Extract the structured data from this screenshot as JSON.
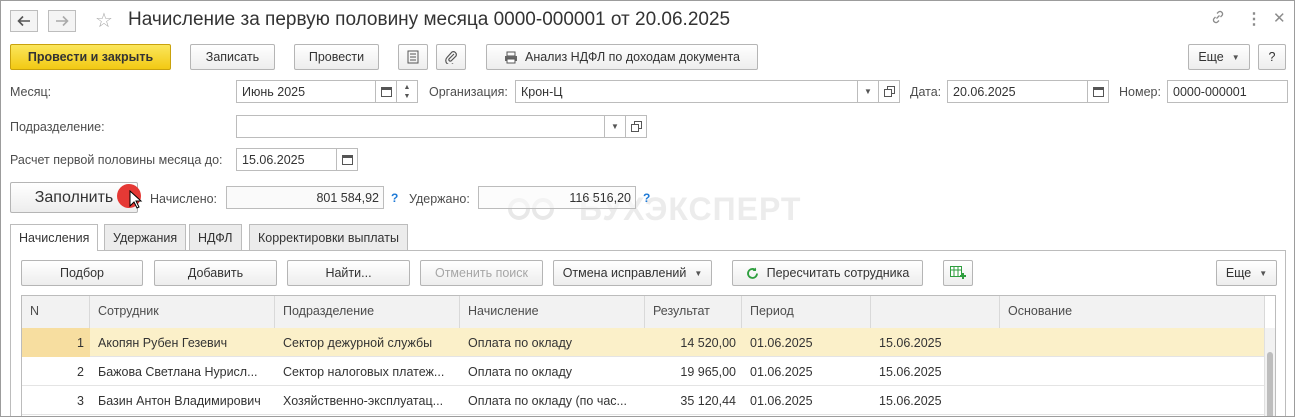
{
  "window": {
    "title": "Начисление за первую половину месяца 0000-000001 от 20.06.2025"
  },
  "toolbar": {
    "post_close": "Провести и закрыть",
    "save": "Записать",
    "post": "Провести",
    "ndfl_analysis": "Анализ НДФЛ по доходам документа",
    "more": "Еще",
    "help": "?"
  },
  "form": {
    "month_label": "Месяц:",
    "month_value": "Июнь 2025",
    "org_label": "Организация:",
    "org_value": "Крон-Ц",
    "date_label": "Дата:",
    "date_value": "20.06.2025",
    "number_label": "Номер:",
    "number_value": "0000-000001",
    "division_label": "Подразделение:",
    "division_value": "",
    "calc_label": "Расчет первой половины месяца до:",
    "calc_value": "15.06.2025",
    "fill_button": "Заполнить",
    "accrued_label": "Начислено:",
    "accrued_value": "801 584,92",
    "withheld_label": "Удержано:",
    "withheld_value": "116 516,20",
    "help_mark": "?"
  },
  "watermark": "БУХЭКСПЕРТ",
  "tabs": [
    {
      "label": "Начисления",
      "active": true
    },
    {
      "label": "Удержания",
      "active": false
    },
    {
      "label": "НДФЛ",
      "active": false
    },
    {
      "label": "Корректировки выплаты",
      "active": false
    }
  ],
  "table_toolbar": {
    "pick": "Подбор",
    "add": "Добавить",
    "find": "Найти...",
    "cancel_search": "Отменить поиск",
    "cancel_corrections": "Отмена исправлений",
    "recalc": "Пересчитать сотрудника",
    "more": "Еще"
  },
  "table": {
    "columns": [
      "N",
      "Сотрудник",
      "Подразделение",
      "Начисление",
      "Результат",
      "Период",
      "",
      "Основание"
    ],
    "rows": [
      [
        "1",
        "Акопян Рубен Гезевич",
        "Сектор дежурной службы",
        "Оплата по окладу",
        "14 520,00",
        "01.06.2025",
        "15.06.2025",
        ""
      ],
      [
        "2",
        "Бажова Светлана Нурисл...",
        "Сектор налоговых платеж...",
        "Оплата по окладу",
        "19 965,00",
        "01.06.2025",
        "15.06.2025",
        ""
      ],
      [
        "3",
        "Базин Антон Владимирович",
        "Хозяйственно-эксплуатац...",
        "Оплата по окладу (по час...",
        "35 120,44",
        "01.06.2025",
        "15.06.2025",
        ""
      ]
    ]
  },
  "colors": {
    "primary_button": "#f2c913",
    "selected_row": "#fbf0c9",
    "help_link": "#1f7ad6",
    "recalc_icon": "#2e9e3e",
    "cursor_dot": "#e53935"
  }
}
